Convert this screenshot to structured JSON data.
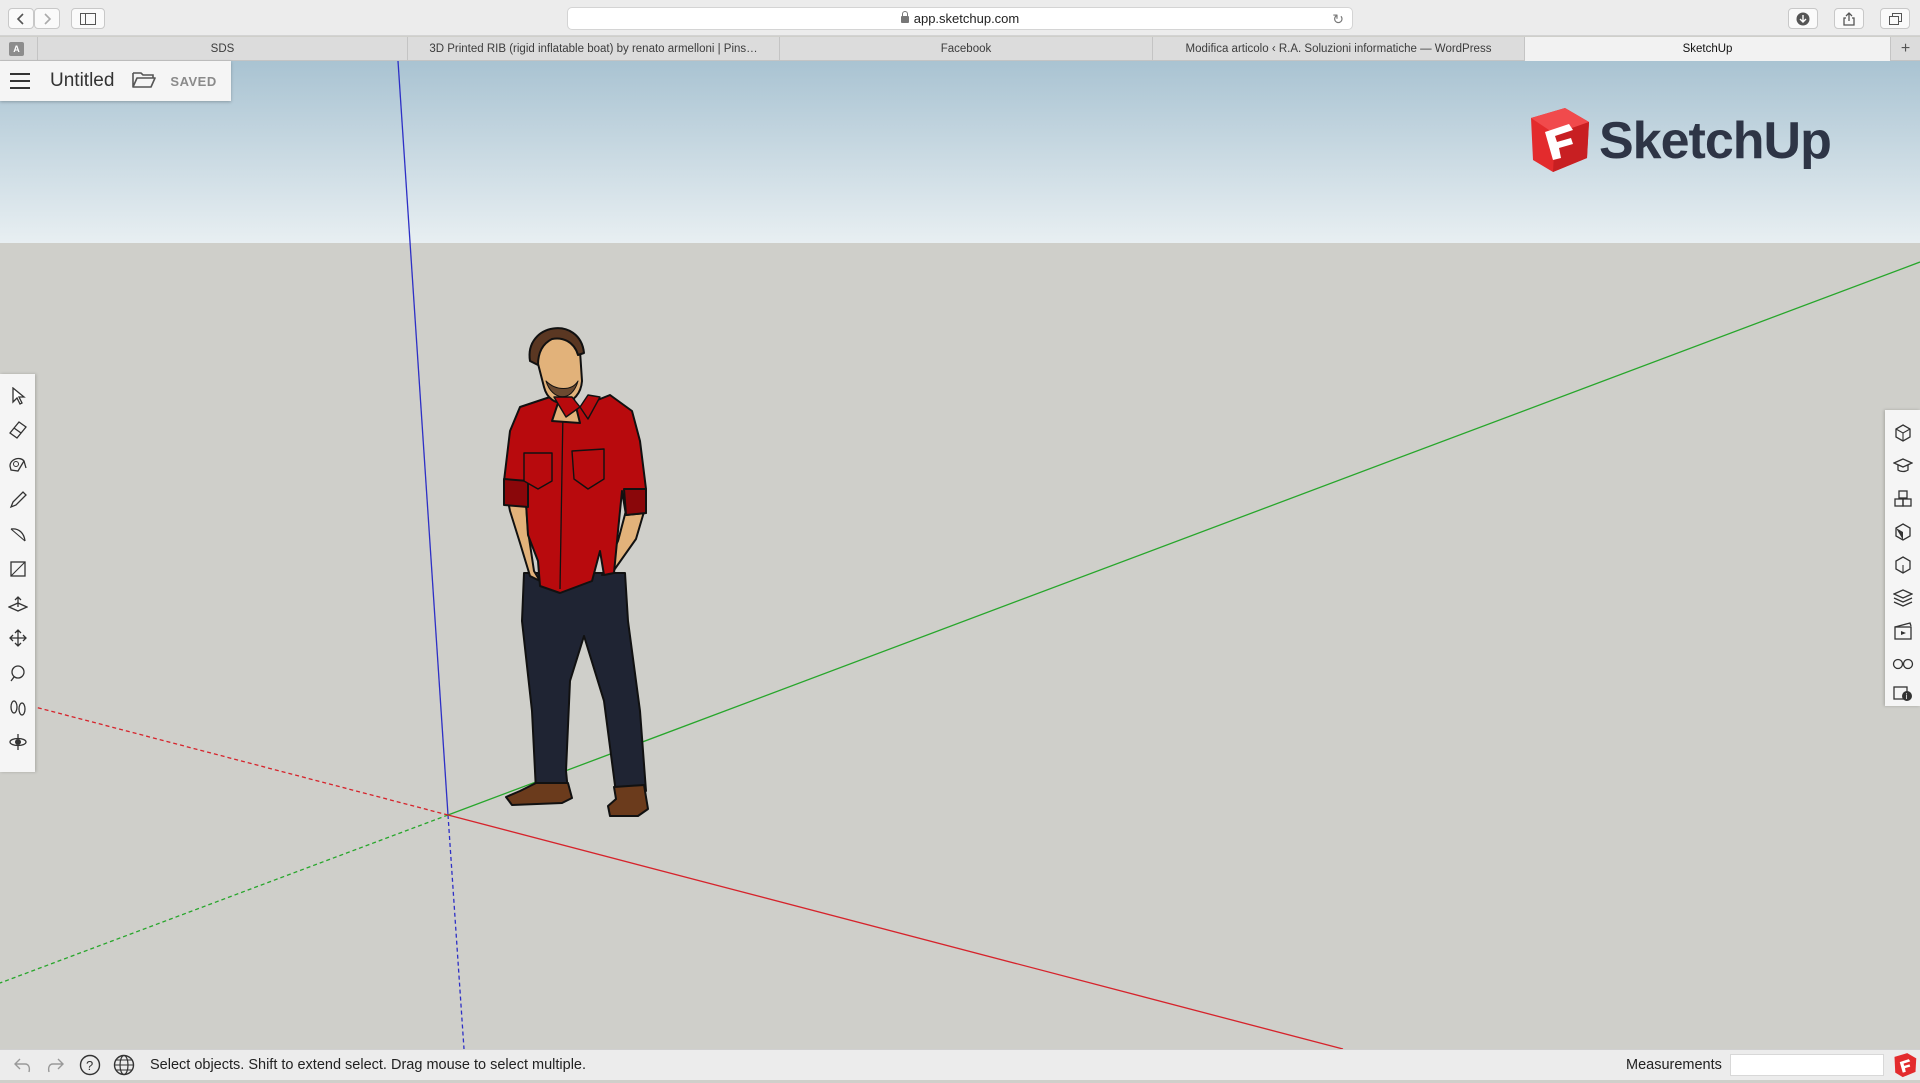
{
  "browser": {
    "url": "app.sketchup.com",
    "tab_pin_letter": "A",
    "tabs": [
      {
        "label": "SDS",
        "active": false
      },
      {
        "label": "3D Printed RIB (rigid inflatable boat) by renato armelloni | Pins…",
        "active": false
      },
      {
        "label": "Facebook",
        "active": false
      },
      {
        "label": "Modifica articolo ‹ R.A. Soluzioni informatiche — WordPress",
        "active": false
      },
      {
        "label": "SketchUp",
        "active": true
      }
    ],
    "new_tab_label": "+"
  },
  "app": {
    "document_title": "Untitled",
    "save_status": "SAVED",
    "logo_text": "SketchUp"
  },
  "left_toolbar": {
    "tools": [
      "select-icon",
      "eraser-icon",
      "paint-bucket-icon",
      "pencil-icon",
      "arc-icon",
      "rectangle-icon",
      "push-pull-icon",
      "move-icon",
      "tape-measure-icon",
      "footprints-icon",
      "orbit-icon"
    ]
  },
  "right_toolbar": {
    "panels": [
      "entity-info-icon",
      "instructor-icon",
      "components-icon",
      "materials-icon",
      "styles-icon",
      "layers-icon",
      "scenes-icon",
      "display-icon",
      "model-info-icon"
    ]
  },
  "statusbar": {
    "hint": "Select objects. Shift to extend select. Drag mouse to select multiple.",
    "measurements_label": "Measurements",
    "measurements_value": ""
  },
  "colors": {
    "sky_top": "#a9c3d2",
    "ground": "#cfcfca",
    "axis_red": "#d6232b",
    "axis_green": "#27a62b",
    "axis_blue": "#2d2fc6",
    "brand_red": "#e32b2d",
    "shirt": "#b80a0d",
    "pants": "#1f2433"
  }
}
